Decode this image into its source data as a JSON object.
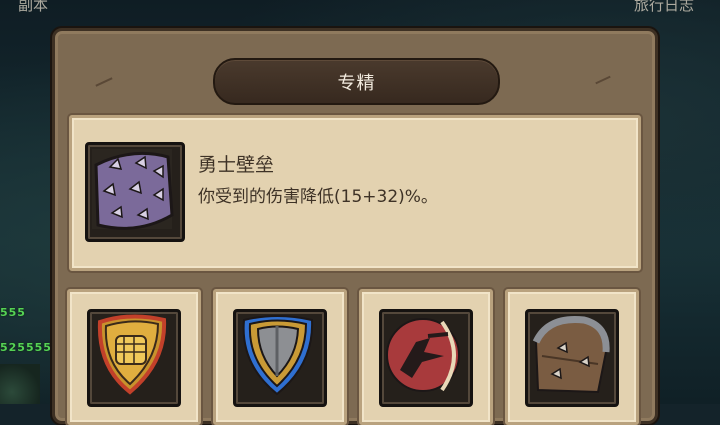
{
  "background": {
    "left_label": "副本",
    "right_label": "旅行日志",
    "damage_numbers": [
      "555",
      "525555"
    ]
  },
  "dialog": {
    "title": "专精",
    "selected_skill": {
      "name": "勇士壁垒",
      "description": "你受到的伤害降低(15+32)%。",
      "icon": "spiked-shield-icon"
    },
    "skill_slots": [
      {
        "icon": "fist-shield-icon"
      },
      {
        "icon": "kite-shield-icon"
      },
      {
        "icon": "warrior-charge-icon"
      },
      {
        "icon": "spiked-round-shield-icon"
      }
    ]
  },
  "colors": {
    "panel": "#7d6a52",
    "card": "#e3d2b0",
    "title_bar": "#3f3126",
    "text_dark": "#3e3226",
    "damage_green": "#55d255"
  }
}
